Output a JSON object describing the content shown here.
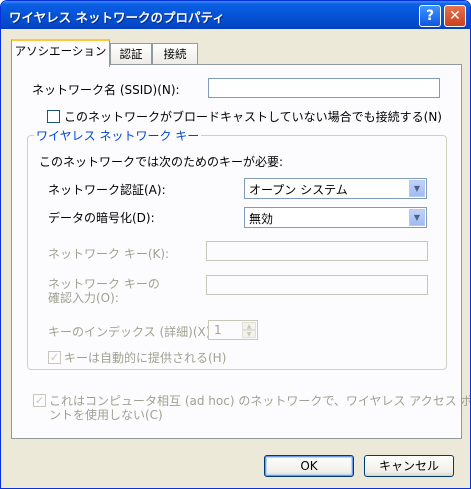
{
  "window": {
    "title": "ワイヤレス ネットワークのプロパティ",
    "help_label": "?",
    "close_label": "✕"
  },
  "tabs": [
    {
      "label": "アソシエーション",
      "active": true
    },
    {
      "label": "認証",
      "active": false
    },
    {
      "label": "接続",
      "active": false
    }
  ],
  "association": {
    "ssid_label": "ネットワーク名 (SSID)(N):",
    "ssid_value": "",
    "broadcast_checkbox_label": "このネットワークがブロードキャストしていない場合でも接続する(N)",
    "broadcast_checked": false,
    "wireless_key_group_title": "ワイヤレス ネットワーク キー",
    "key_required_text": "このネットワークでは次のためのキーが必要:",
    "auth_label": "ネットワーク認証(A):",
    "auth_value": "オープン システム",
    "encryption_label": "データの暗号化(D):",
    "encryption_value": "無効",
    "network_key_label": "ネットワーク キー(K):",
    "confirm_key_label_line1": "ネットワーク キーの",
    "confirm_key_label_line2": "確認入力(O):",
    "key_index_label": "キーのインデックス (詳細)(X):",
    "key_index_value": "1",
    "auto_key_label": "キーは自動的に提供される(H)",
    "auto_key_checked": true,
    "adhoc_label_line1": "これはコンピュータ相互 (ad hoc) のネットワークで、ワイヤレス アクセス ポイ",
    "adhoc_label_line2": "ントを使用しない(C)",
    "adhoc_checked": true
  },
  "buttons": {
    "ok_label": "OK",
    "cancel_label": "キャンセル"
  },
  "icons": {
    "dropdown": "chevron-down-icon",
    "check": "checkmark-icon",
    "spin_up": "spin-up-icon",
    "spin_down": "spin-down-icon"
  },
  "colors": {
    "title_bar": "#0553d6",
    "group_title": "#0046d5",
    "disabled_text": "#a1a192",
    "dialog_bg": "#ece9d8"
  }
}
